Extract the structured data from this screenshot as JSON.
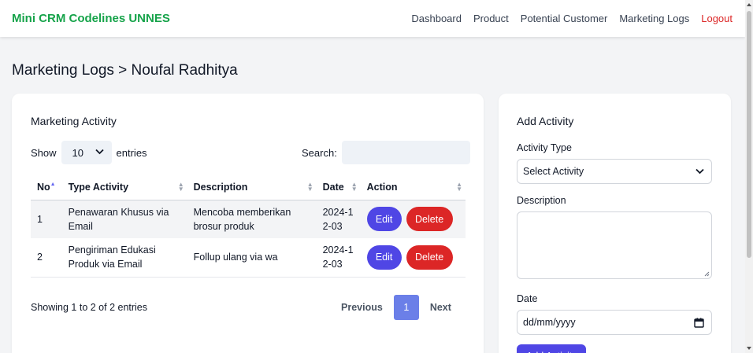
{
  "navbar": {
    "brand": "Mini CRM Codelines UNNES",
    "links": [
      "Dashboard",
      "Product",
      "Potential Customer",
      "Marketing Logs"
    ],
    "logout": "Logout"
  },
  "page": {
    "title": "Marketing Logs > Noufal Radhitya"
  },
  "activity_table": {
    "title": "Marketing Activity",
    "show_label": "Show",
    "entries_value": "10",
    "entries_label": "entries",
    "search_label": "Search:",
    "columns": [
      "No",
      "Type Activity",
      "Description",
      "Date",
      "Action"
    ],
    "rows": [
      {
        "no": "1",
        "type": "Penawaran Khusus via Email",
        "description": "Mencoba memberikan brosur produk",
        "date": "2024-12-03"
      },
      {
        "no": "2",
        "type": "Pengiriman Edukasi Produk via Email",
        "description": "Follup ulang via wa",
        "date": "2024-12-03"
      }
    ],
    "edit_label": "Edit",
    "delete_label": "Delete",
    "info": "Showing 1 to 2 of 2 entries",
    "pagination": {
      "previous": "Previous",
      "current": "1",
      "next": "Next"
    }
  },
  "add_activity": {
    "title": "Add Activity",
    "activity_type_label": "Activity Type",
    "activity_type_placeholder": "Select Activity",
    "description_label": "Description",
    "date_label": "Date",
    "date_placeholder": "dd/mm/yyyy",
    "submit_label": "Add Activity"
  },
  "colors": {
    "brand": "#16a34a",
    "primary": "#4f46e5",
    "danger": "#dc2626",
    "page_active": "#6b7fe8"
  }
}
